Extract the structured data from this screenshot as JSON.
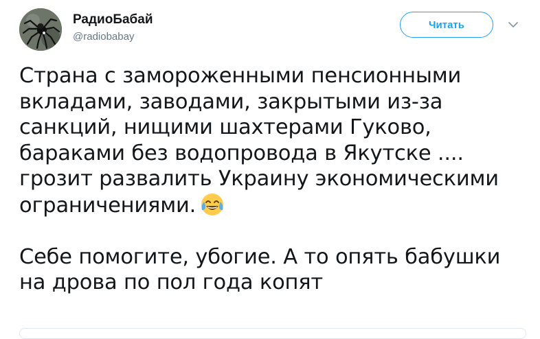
{
  "author": {
    "display_name": "РадиоБабай",
    "handle": "@radiobabay"
  },
  "follow_button": {
    "label": "Читать"
  },
  "icons": {
    "avatar": "spider-avatar-icon",
    "more": "chevron-down-icon",
    "emoji": "face-with-tears-of-joy-icon"
  },
  "tweet": {
    "lines": [
      "Страна с замороженными пенсионными",
      "вкладами, заводами, закрытыми из-за",
      "санкций, нищими шахтерами Гуково,",
      "бараками без водопровода в Якутске ....",
      "грозит развалить Украину экономическими",
      "ограничениями."
    ],
    "lines2": [
      "Себе помогите, убогие. А то опять бабушки",
      "на дрова по пол года копят"
    ]
  },
  "colors": {
    "accent": "#1da1f2",
    "text": "#14171a",
    "secondary": "#657786"
  }
}
